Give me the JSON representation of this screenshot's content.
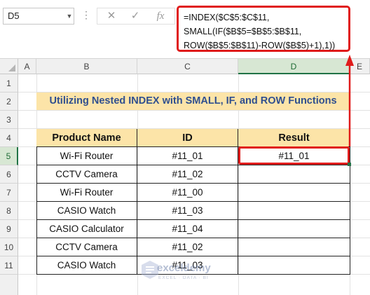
{
  "formula_bar": {
    "name_box": "D5",
    "fx_label": "fx",
    "cancel_icon": "cancel-icon",
    "enter_icon": "checkmark-icon",
    "formula_lines": [
      "=INDEX($C$5:$C$11,",
      "SMALL(IF($B$5=$B$5:$B$11,",
      "ROW($B$5:$B$11)-ROW($B$5)+1),1))"
    ]
  },
  "columns": [
    "A",
    "B",
    "C",
    "D",
    "E"
  ],
  "selected_column": "D",
  "rows": [
    "1",
    "2",
    "3",
    "4",
    "5",
    "6",
    "7",
    "8",
    "9",
    "10",
    "11"
  ],
  "selected_row": "5",
  "sheet": {
    "title": "Utilizing Nested INDEX with SMALL, IF, and ROW Functions",
    "table": {
      "headers": [
        "Product Name",
        "ID",
        "Result"
      ],
      "rows": [
        [
          "Wi-Fi Router",
          "#11_01",
          "#11_01"
        ],
        [
          "CCTV Camera",
          "#11_02",
          ""
        ],
        [
          "Wi-Fi Router",
          "#11_00",
          ""
        ],
        [
          "CASIO Watch",
          "#11_03",
          ""
        ],
        [
          "CASIO Calculator",
          "#11_04",
          ""
        ],
        [
          "CCTV Camera",
          "#11_02",
          ""
        ],
        [
          "CASIO Watch",
          "#11_03",
          ""
        ]
      ]
    }
  },
  "watermark": {
    "name": "exceldemy",
    "tagline": "EXCEL · DATA · BI"
  },
  "colors": {
    "highlight_red": "#e01b1b",
    "title_fill": "#fce4a8",
    "title_text": "#2f4f8f",
    "selection_green": "#217346"
  }
}
